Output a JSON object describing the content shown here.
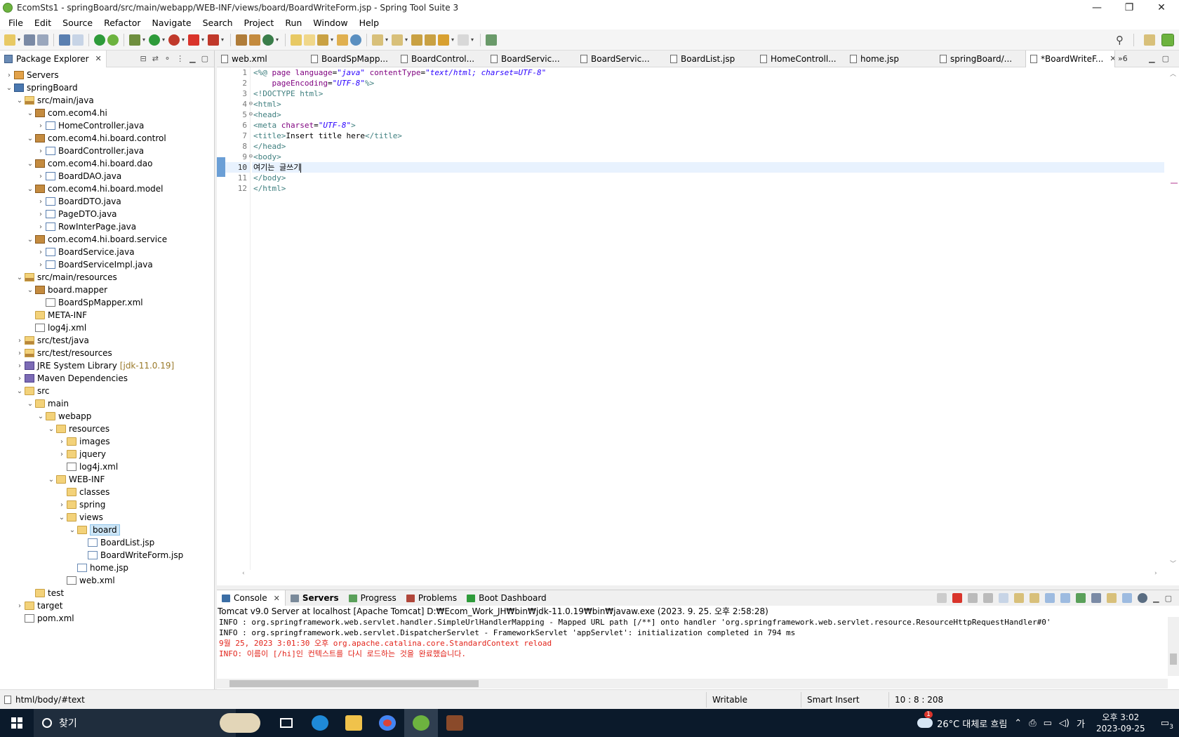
{
  "window": {
    "title": "EcomSts1 - springBoard/src/main/webapp/WEB-INF/views/board/BoardWriteForm.jsp - Spring Tool Suite 3",
    "minimize": "—",
    "restore": "❐",
    "close": "✕"
  },
  "menu": [
    "File",
    "Edit",
    "Source",
    "Refactor",
    "Navigate",
    "Search",
    "Project",
    "Run",
    "Window",
    "Help"
  ],
  "package_explorer": {
    "tab_label": "Package Explorer",
    "tree": [
      {
        "label": "Servers",
        "depth": 0,
        "arrow": "›",
        "icon": "ic-server"
      },
      {
        "label": "springBoard",
        "depth": 0,
        "arrow": "⌄",
        "icon": "ic-project"
      },
      {
        "label": "src/main/java",
        "depth": 1,
        "arrow": "⌄",
        "icon": "ic-srcfolder"
      },
      {
        "label": "com.ecom4.hi",
        "depth": 2,
        "arrow": "⌄",
        "icon": "ic-package"
      },
      {
        "label": "HomeController.java",
        "depth": 3,
        "arrow": "›",
        "icon": "ic-java"
      },
      {
        "label": "com.ecom4.hi.board.control",
        "depth": 2,
        "arrow": "⌄",
        "icon": "ic-package"
      },
      {
        "label": "BoardController.java",
        "depth": 3,
        "arrow": "›",
        "icon": "ic-java"
      },
      {
        "label": "com.ecom4.hi.board.dao",
        "depth": 2,
        "arrow": "⌄",
        "icon": "ic-package"
      },
      {
        "label": "BoardDAO.java",
        "depth": 3,
        "arrow": "›",
        "icon": "ic-java"
      },
      {
        "label": "com.ecom4.hi.board.model",
        "depth": 2,
        "arrow": "⌄",
        "icon": "ic-package"
      },
      {
        "label": "BoardDTO.java",
        "depth": 3,
        "arrow": "›",
        "icon": "ic-java"
      },
      {
        "label": "PageDTO.java",
        "depth": 3,
        "arrow": "›",
        "icon": "ic-java"
      },
      {
        "label": "RowInterPage.java",
        "depth": 3,
        "arrow": "›",
        "icon": "ic-java"
      },
      {
        "label": "com.ecom4.hi.board.service",
        "depth": 2,
        "arrow": "⌄",
        "icon": "ic-package"
      },
      {
        "label": "BoardService.java",
        "depth": 3,
        "arrow": "›",
        "icon": "ic-java"
      },
      {
        "label": "BoardServiceImpl.java",
        "depth": 3,
        "arrow": "›",
        "icon": "ic-java"
      },
      {
        "label": "src/main/resources",
        "depth": 1,
        "arrow": "⌄",
        "icon": "ic-srcfolder"
      },
      {
        "label": "board.mapper",
        "depth": 2,
        "arrow": "⌄",
        "icon": "ic-package"
      },
      {
        "label": "BoardSpMapper.xml",
        "depth": 3,
        "arrow": "",
        "icon": "ic-xml"
      },
      {
        "label": "META-INF",
        "depth": 2,
        "arrow": "",
        "icon": "ic-folder"
      },
      {
        "label": "log4j.xml",
        "depth": 2,
        "arrow": "",
        "icon": "ic-xml"
      },
      {
        "label": "src/test/java",
        "depth": 1,
        "arrow": "›",
        "icon": "ic-srcfolder"
      },
      {
        "label": "src/test/resources",
        "depth": 1,
        "arrow": "›",
        "icon": "ic-srcfolder"
      },
      {
        "label": "JRE System Library",
        "deco": "[jdk-11.0.19]",
        "depth": 1,
        "arrow": "›",
        "icon": "ic-lib"
      },
      {
        "label": "Maven Dependencies",
        "depth": 1,
        "arrow": "›",
        "icon": "ic-lib"
      },
      {
        "label": "src",
        "depth": 1,
        "arrow": "⌄",
        "icon": "ic-folder"
      },
      {
        "label": "main",
        "depth": 2,
        "arrow": "⌄",
        "icon": "ic-folder"
      },
      {
        "label": "webapp",
        "depth": 3,
        "arrow": "⌄",
        "icon": "ic-folder"
      },
      {
        "label": "resources",
        "depth": 4,
        "arrow": "⌄",
        "icon": "ic-folder"
      },
      {
        "label": "images",
        "depth": 5,
        "arrow": "›",
        "icon": "ic-folder"
      },
      {
        "label": "jquery",
        "depth": 5,
        "arrow": "›",
        "icon": "ic-folder"
      },
      {
        "label": "log4j.xml",
        "depth": 5,
        "arrow": "",
        "icon": "ic-xml"
      },
      {
        "label": "WEB-INF",
        "depth": 4,
        "arrow": "⌄",
        "icon": "ic-folder"
      },
      {
        "label": "classes",
        "depth": 5,
        "arrow": "",
        "icon": "ic-folder"
      },
      {
        "label": "spring",
        "depth": 5,
        "arrow": "›",
        "icon": "ic-folder"
      },
      {
        "label": "views",
        "depth": 5,
        "arrow": "⌄",
        "icon": "ic-folder"
      },
      {
        "label": "board",
        "depth": 6,
        "arrow": "⌄",
        "icon": "ic-folder",
        "selected": true
      },
      {
        "label": "BoardList.jsp",
        "depth": 7,
        "arrow": "",
        "icon": "ic-jsp"
      },
      {
        "label": "BoardWriteForm.jsp",
        "depth": 7,
        "arrow": "",
        "icon": "ic-jsp"
      },
      {
        "label": "home.jsp",
        "depth": 6,
        "arrow": "",
        "icon": "ic-jsp"
      },
      {
        "label": "web.xml",
        "depth": 5,
        "arrow": "",
        "icon": "ic-xml"
      },
      {
        "label": "test",
        "depth": 2,
        "arrow": "",
        "icon": "ic-folder"
      },
      {
        "label": "target",
        "depth": 1,
        "arrow": "›",
        "icon": "ic-folder"
      },
      {
        "label": "pom.xml",
        "depth": 1,
        "arrow": "",
        "icon": "ic-xml"
      }
    ]
  },
  "editor": {
    "tabs": [
      {
        "label": "web.xml",
        "active": false
      },
      {
        "label": "BoardSpMapp...",
        "active": false
      },
      {
        "label": "BoardControl...",
        "active": false
      },
      {
        "label": "BoardServic...",
        "active": false
      },
      {
        "label": "BoardServic...",
        "active": false
      },
      {
        "label": "BoardList.jsp",
        "active": false
      },
      {
        "label": "HomeControll...",
        "active": false
      },
      {
        "label": "home.jsp",
        "active": false
      },
      {
        "label": "springBoard/...",
        "active": false
      },
      {
        "label": "*BoardWriteF...",
        "active": true
      }
    ],
    "overflow": "»6",
    "lines": [
      {
        "n": "1",
        "fold": "",
        "segs": [
          [
            "t-tag",
            "<%@ "
          ],
          [
            "t-attr",
            "page "
          ],
          [
            "t-attr",
            "language"
          ],
          [
            "t-txt",
            "="
          ],
          [
            "t-str",
            "\"java\""
          ],
          [
            "t-txt",
            " "
          ],
          [
            "t-attr",
            "contentType"
          ],
          [
            "t-txt",
            "="
          ],
          [
            "t-str",
            "\"text/html; charset=UTF-8\""
          ]
        ]
      },
      {
        "n": "2",
        "fold": "",
        "segs": [
          [
            "t-txt",
            "    "
          ],
          [
            "t-attr",
            "pageEncoding"
          ],
          [
            "t-txt",
            "="
          ],
          [
            "t-str",
            "\"UTF-8\""
          ],
          [
            "t-tag",
            "%>"
          ]
        ]
      },
      {
        "n": "3",
        "fold": "",
        "segs": [
          [
            "t-tag",
            "<!DOCTYPE html>"
          ]
        ]
      },
      {
        "n": "4",
        "fold": "⊖",
        "segs": [
          [
            "t-tag",
            "<html>"
          ]
        ]
      },
      {
        "n": "5",
        "fold": "⊖",
        "segs": [
          [
            "t-tag",
            "<head>"
          ]
        ]
      },
      {
        "n": "6",
        "fold": "",
        "segs": [
          [
            "t-tag",
            "<meta "
          ],
          [
            "t-attr",
            "charset"
          ],
          [
            "t-txt",
            "="
          ],
          [
            "t-str",
            "\"UTF-8\""
          ],
          [
            "t-tag",
            ">"
          ]
        ]
      },
      {
        "n": "7",
        "fold": "",
        "segs": [
          [
            "t-tag",
            "<title>"
          ],
          [
            "t-txt",
            "Insert title here"
          ],
          [
            "t-tag",
            "</title>"
          ]
        ]
      },
      {
        "n": "8",
        "fold": "",
        "segs": [
          [
            "t-tag",
            "</head>"
          ]
        ]
      },
      {
        "n": "9",
        "fold": "⊖",
        "segs": [
          [
            "t-tag",
            "<body>"
          ]
        ]
      },
      {
        "n": "10",
        "fold": "",
        "current": true,
        "segs": [
          [
            "t-txt",
            "여기는 글쓰기"
          ]
        ]
      },
      {
        "n": "11",
        "fold": "",
        "segs": [
          [
            "t-tag",
            "</body>"
          ]
        ]
      },
      {
        "n": "12",
        "fold": "",
        "segs": [
          [
            "t-tag",
            "</html>"
          ]
        ]
      }
    ]
  },
  "console": {
    "tabs": [
      {
        "label": "Console",
        "active": true,
        "bold": false,
        "closable": true,
        "color": "#3b6ea5"
      },
      {
        "label": "Servers",
        "active": false,
        "bold": true,
        "closable": false,
        "color": "#7a8a9a"
      },
      {
        "label": "Progress",
        "active": false,
        "bold": false,
        "closable": false,
        "color": "#5aa05a"
      },
      {
        "label": "Problems",
        "active": false,
        "bold": false,
        "closable": false,
        "color": "#b0463a"
      },
      {
        "label": "Boot Dashboard",
        "active": false,
        "bold": false,
        "closable": false,
        "color": "#2e9b3a"
      }
    ],
    "description": "Tomcat v9.0 Server at localhost [Apache Tomcat] D:₩Ecom_Work_JH₩bin₩jdk-11.0.19₩bin₩javaw.exe  (2023. 9. 25. 오후 2:58:28)",
    "lines": [
      {
        "text": "INFO : org.springframework.web.servlet.handler.SimpleUrlHandlerMapping - Mapped URL path [/**] onto handler 'org.springframework.web.servlet.resource.ResourceHttpRequestHandler#0'",
        "color": "black"
      },
      {
        "text": "INFO : org.springframework.web.servlet.DispatcherServlet - FrameworkServlet 'appServlet': initialization completed in 794 ms",
        "color": "black"
      },
      {
        "text": "9월 25, 2023 3:01:30 오후 org.apache.catalina.core.StandardContext reload",
        "color": "red"
      },
      {
        "text": "INFO: 이름이 [/hi]인 컨텍스트를 다시 로드하는 것을 완료했습니다.",
        "color": "red"
      }
    ]
  },
  "status": {
    "path": "html/body/#text",
    "writable": "Writable",
    "insert_mode": "Smart Insert",
    "position": "10 : 8 : 208"
  },
  "taskbar": {
    "search_placeholder": "찾기",
    "weather": "26°C 대체로 흐림",
    "ime": "가",
    "time": "오후 3:02",
    "date": "2023-09-25",
    "notification_count": "3",
    "weather_badge": "1"
  },
  "colors": {
    "accent": "#6b9fd6",
    "spring_green": "#6db33f",
    "selection": "#cde6f7"
  }
}
